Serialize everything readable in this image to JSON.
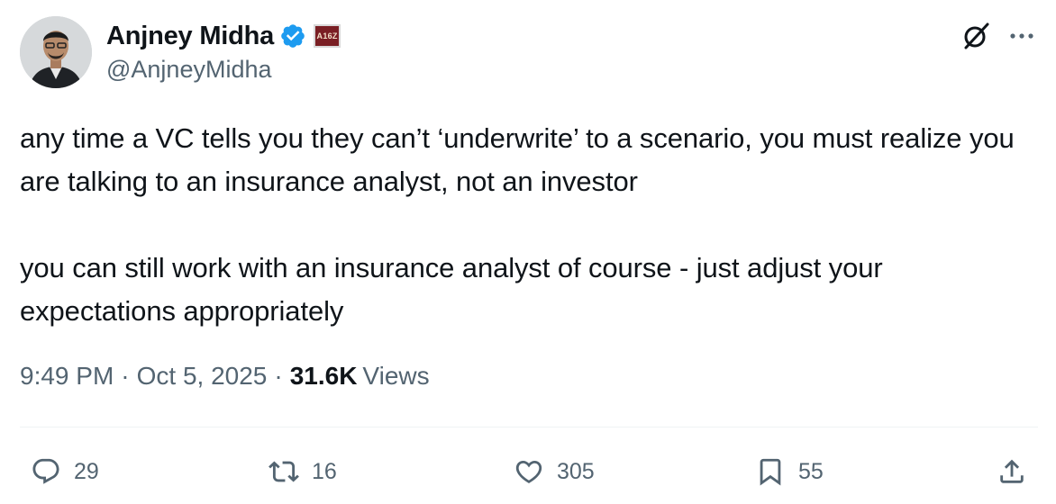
{
  "author": {
    "display_name": "Anjney Midha",
    "handle": "@AnjneyMidha",
    "verified": true,
    "affiliation_badge": "A16Z"
  },
  "tweet": {
    "paragraphs": [
      "any time a VC tells you they can’t ‘underwrite’ to a scenario, you must realize you are talking to an insurance analyst, not an investor",
      "you can still work with an insurance analyst of course - just adjust your expectations appropriately"
    ],
    "time": "9:49 PM",
    "separator": "·",
    "date": "Oct 5, 2025",
    "views_count": "31.6K",
    "views_label": "Views"
  },
  "actions": {
    "replies": "29",
    "reposts": "16",
    "likes": "305",
    "bookmarks": "55"
  },
  "icons": {
    "verified": "verified-badge-icon",
    "grok": "grok-icon",
    "more": "more-icon",
    "reply": "reply-icon",
    "repost": "repost-icon",
    "like": "like-icon",
    "bookmark": "bookmark-icon",
    "share": "share-icon"
  },
  "colors": {
    "text": "#0f1419",
    "secondary": "#536471",
    "verified_blue": "#1d9bf0",
    "divider": "#eff3f4",
    "affiliation_bg": "#7a1f24"
  }
}
